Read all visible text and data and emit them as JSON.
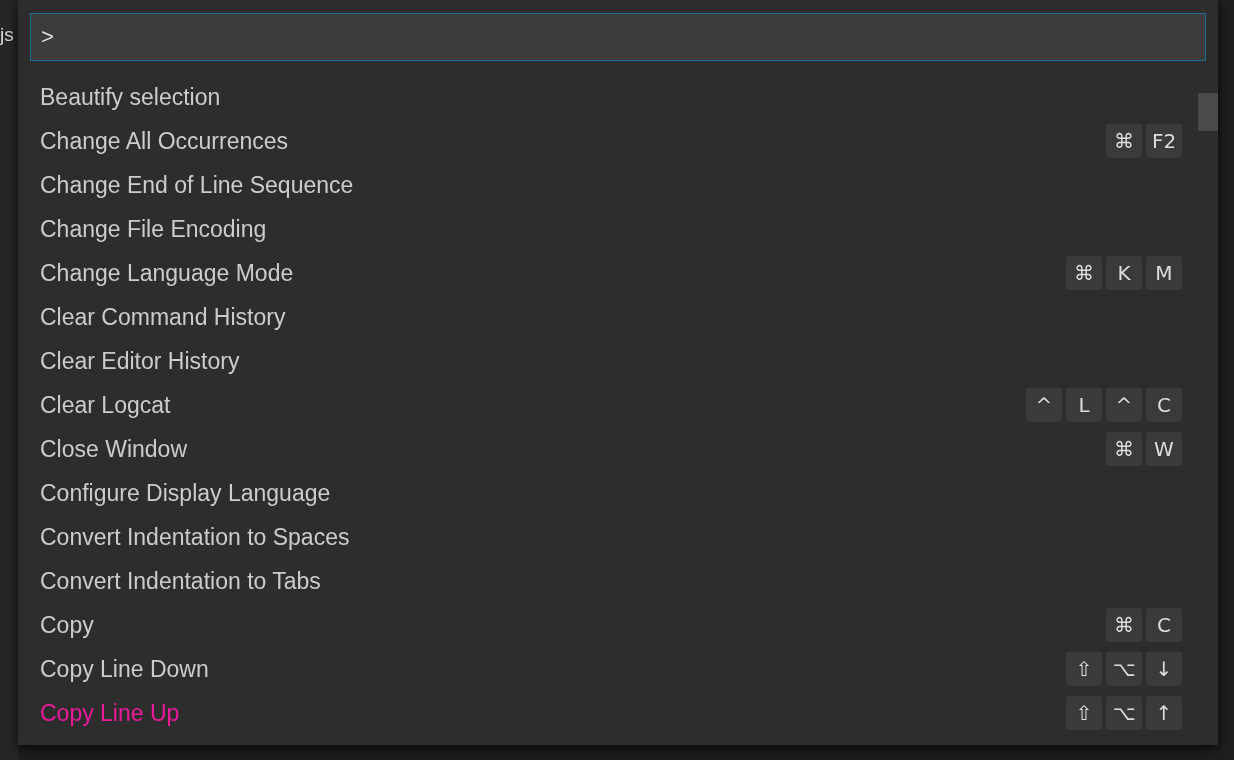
{
  "editor": {
    "tab_label": "js"
  },
  "command_palette": {
    "input": {
      "value": ">"
    },
    "commands": [
      {
        "label": "Beautify selection",
        "selected": false
      },
      {
        "label": "Change All Occurrences",
        "keys": [
          "⌘",
          "F2"
        ],
        "selected": false
      },
      {
        "label": "Change End of Line Sequence",
        "selected": false
      },
      {
        "label": "Change File Encoding",
        "selected": false
      },
      {
        "label": "Change Language Mode",
        "keys": [
          "⌘",
          "K",
          "M"
        ],
        "selected": false
      },
      {
        "label": "Clear Command History",
        "selected": false
      },
      {
        "label": "Clear Editor History",
        "selected": false
      },
      {
        "label": "Clear Logcat",
        "keys": [
          "^",
          "L",
          "^",
          "C"
        ],
        "selected": false
      },
      {
        "label": "Close Window",
        "keys": [
          "⌘",
          "W"
        ],
        "selected": false
      },
      {
        "label": "Configure Display Language",
        "selected": false
      },
      {
        "label": "Convert Indentation to Spaces",
        "selected": false
      },
      {
        "label": "Convert Indentation to Tabs",
        "selected": false
      },
      {
        "label": "Copy",
        "keys": [
          "⌘",
          "C"
        ],
        "selected": false
      },
      {
        "label": "Copy Line Down",
        "keys": [
          "⇧",
          "⌥",
          "↓"
        ],
        "selected": false
      },
      {
        "label": "Copy Line Up",
        "keys": [
          "⇧",
          "⌥",
          "↑"
        ],
        "selected": true
      }
    ]
  }
}
